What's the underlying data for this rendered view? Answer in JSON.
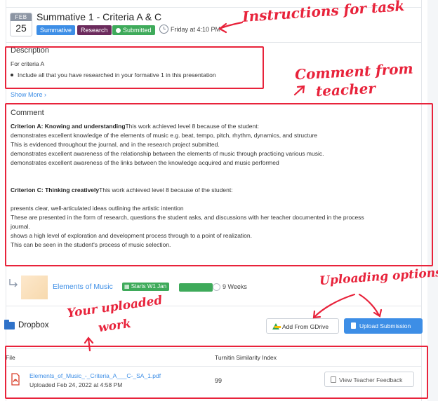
{
  "header": {
    "month": "FEB",
    "day": "25",
    "title": "Summative 1 - Criteria A & C",
    "tags": [
      "Summative",
      "Research",
      "Submitted"
    ],
    "due": "Friday at 4:10 PM"
  },
  "description": {
    "heading": "Description",
    "lines": [
      "For criteria A",
      "Include all that you have researched in your formative 1 in this presentation"
    ],
    "show_more": "Show More ›"
  },
  "comment": {
    "heading": "Comment",
    "lines": [
      {
        "bold": "Criterion A: Knowing and understanding",
        "text": "This work achieved level 8 because of the student:"
      },
      {
        "bold": "",
        "text": "demonstrates excellent knowledge of the elements of music e.g. beat, tempo, pitch, rhythm, dynamics, and structure"
      },
      {
        "bold": "",
        "text": "This is evidenced throughout the journal, and in the research project submitted."
      },
      {
        "bold": "",
        "text": "demonstrates excellent awareness of the relationship between the elements of music through practicing various music."
      },
      {
        "bold": "",
        "text": "demonstrates excellent awareness of the links between the knowledge acquired and music performed"
      },
      {
        "bold": "Criterion C: Thinking creatively",
        "text": "This work achieved level 8 because of the student:"
      },
      {
        "bold": "",
        "text": "presents clear, well-articulated ideas outlining the artistic intention"
      },
      {
        "bold": "",
        "text": "These are presented in the form of research, questions the student asks, and discussions with her teacher documented in the process"
      },
      {
        "bold": "",
        "text": "journal."
      },
      {
        "bold": "",
        "text": "shows a high level of exploration and development process through to a point of realization."
      },
      {
        "bold": "",
        "text": "This can be seen in the student's process of music selection."
      }
    ]
  },
  "lesson": {
    "title": "Elements of Music",
    "starts": "Starts W1 Jan",
    "progress": 1.0,
    "duration": "9 Weeks"
  },
  "dropbox": {
    "title": "Dropbox",
    "gdrive_button": "Add From GDrive",
    "upload_button": "Upload Submission",
    "col_file": "File",
    "col_similarity": "Turnitin Similarity Index",
    "file_name": "Elements_of_Music_-_Criteria_A___C-_SA_1.pdf",
    "uploaded": "Uploaded Feb 24, 2022 at 4:58 PM",
    "similarity": "99",
    "feedback_button": "View Teacher Feedback"
  },
  "annotations": {
    "instructions": "Instructions for task",
    "comment_line1": "Comment from",
    "comment_line2": "teacher",
    "uploading": "Uploading options",
    "uploaded_line1": "Your uploaded",
    "uploaded_line2": "work"
  },
  "colors": {
    "accent_blue": "#3d8ee6",
    "tag_purple": "#6b2a5c",
    "status_green": "#3eaa5a",
    "annotation_red": "#e8233b"
  },
  "icons": [
    "clock-icon",
    "return-arrow-icon",
    "folder-icon",
    "gdrive-icon",
    "upload-icon",
    "pdf-icon",
    "feedback-icon"
  ]
}
